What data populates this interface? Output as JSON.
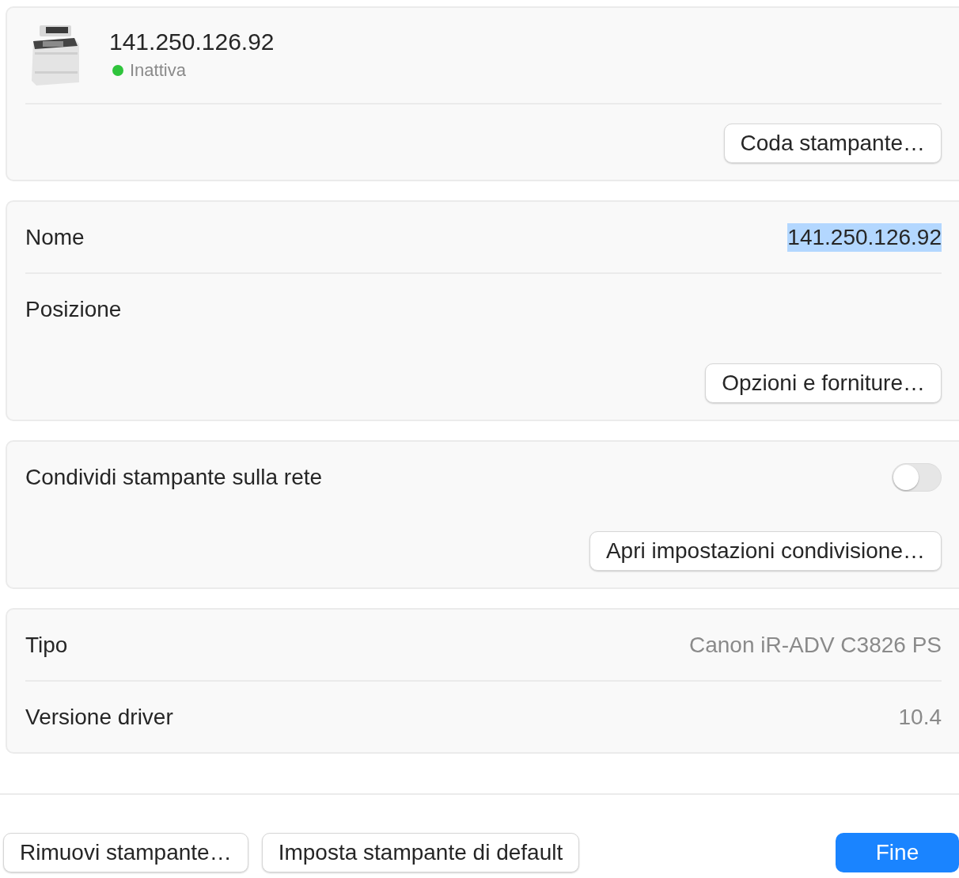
{
  "printer": {
    "name": "141.250.126.92",
    "status": {
      "label": "Inattiva",
      "color": "#2fc43c"
    },
    "queue_button": "Coda stampante…"
  },
  "sections": [
    {
      "rows": [
        {
          "kind": "field",
          "label": "Nome",
          "value": "141.250.126.92",
          "selected": true
        },
        {
          "kind": "field",
          "label": "Posizione"
        },
        {
          "kind": "button",
          "label": "Opzioni e forniture…"
        }
      ]
    },
    {
      "rows": [
        {
          "kind": "toggle",
          "label": "Condividi stampante sulla rete",
          "on": false
        },
        {
          "kind": "button",
          "label": "Apri impostazioni condivisione…"
        }
      ]
    },
    {
      "rows": [
        {
          "kind": "info",
          "label": "Tipo",
          "value": "Canon iR-ADV C3826 PS"
        },
        {
          "kind": "info",
          "label": "Versione driver",
          "value": "10.4"
        }
      ]
    }
  ],
  "footer": [
    {
      "kind": "secondary",
      "label": "Rimuovi stampante…"
    },
    {
      "kind": "secondary",
      "label": "Imposta stampante di default"
    },
    {
      "kind": "primary",
      "label": "Fine"
    }
  ]
}
